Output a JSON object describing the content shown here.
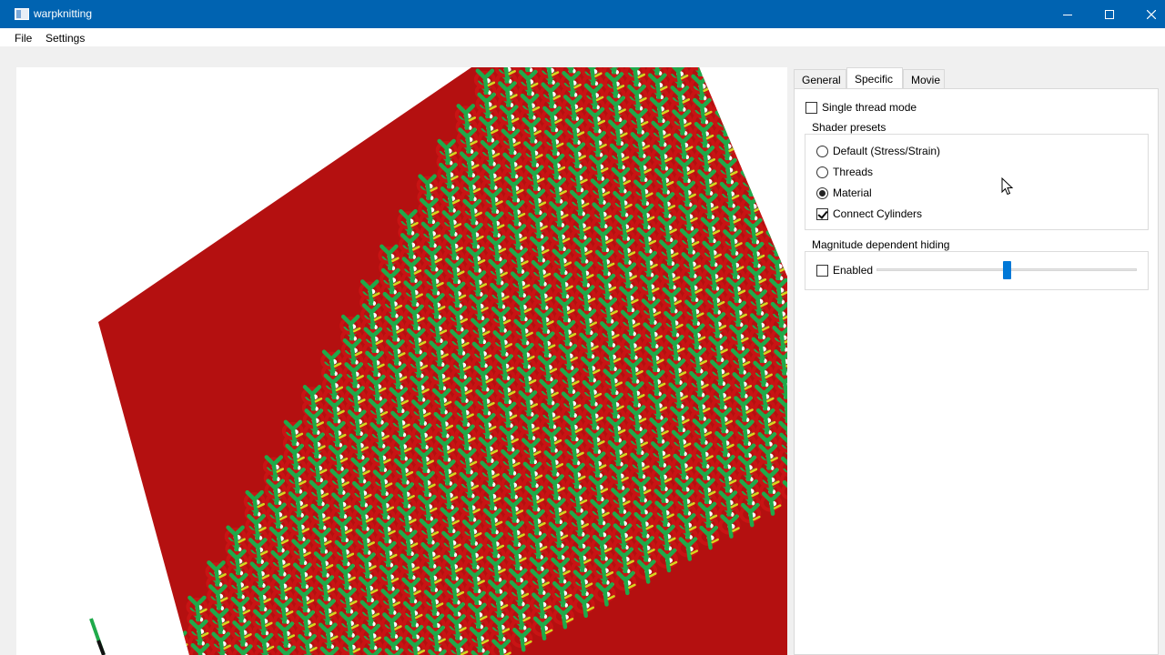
{
  "window": {
    "title": "warpknitting"
  },
  "menu": {
    "file": "File",
    "settings": "Settings"
  },
  "tabs": [
    {
      "label": "General"
    },
    {
      "label": "Specific",
      "active": true
    },
    {
      "label": "Movie"
    }
  ],
  "panel": {
    "single_thread": {
      "label": "Single thread mode",
      "checked": false
    },
    "shader_presets": {
      "title": "Shader presets",
      "options": [
        {
          "label": "Default (Stress/Strain)",
          "selected": false
        },
        {
          "label": "Threads",
          "selected": false
        },
        {
          "label": "Material",
          "selected": true
        }
      ],
      "connect_cylinders": {
        "label": "Connect Cylinders",
        "checked": true
      }
    },
    "magnitude_hiding": {
      "title": "Magnitude dependent hiding",
      "enabled": {
        "label": "Enabled",
        "checked": false
      },
      "slider_value": 0.5
    }
  },
  "colors": {
    "titlebar": "#0063b1",
    "thread_red": "#c81414",
    "thread_green": "#1faa4a",
    "thread_yellow": "#d6d61e",
    "accent": "#0078d7"
  },
  "icons": {
    "app": "app-window-icon",
    "minimize": "minimize-icon",
    "maximize": "maximize-icon",
    "close": "close-icon",
    "cursor": "mouse-cursor-icon"
  }
}
